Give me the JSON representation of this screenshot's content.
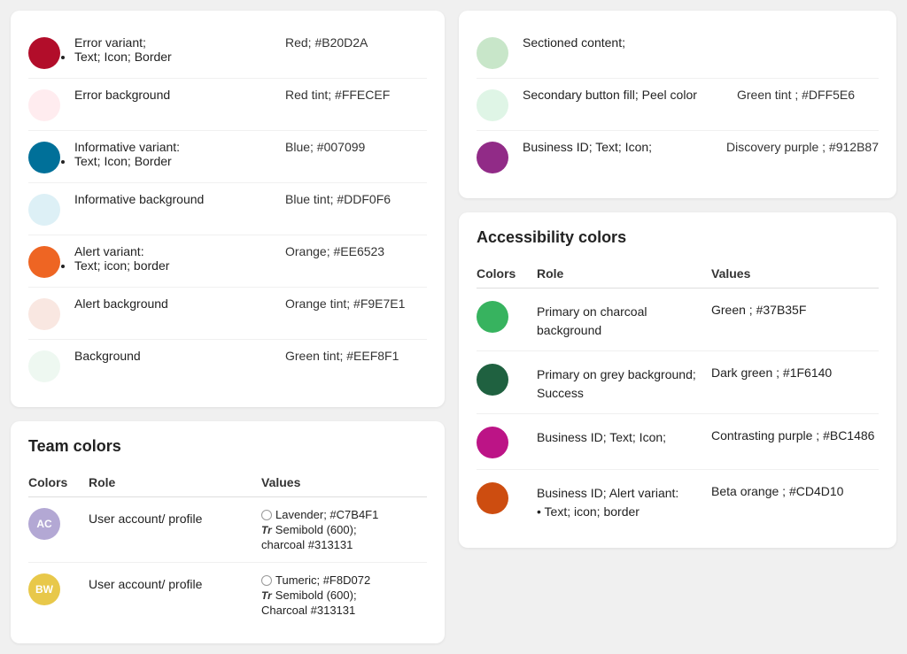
{
  "left": {
    "status_colors": {
      "rows": [
        {
          "color": "#B20D2A",
          "role": "Error variant;",
          "sub": "Text; Icon; Border",
          "value": "Red; #B20D2A"
        },
        {
          "color": "#FFECEF",
          "role": "Error background",
          "sub": null,
          "value": "Red tint; #FFECEF"
        },
        {
          "color": "#007099",
          "role": "Informative variant:",
          "sub": "Text; Icon; Border",
          "value": "Blue; #007099"
        },
        {
          "color": "#DDF0F6",
          "role": "Informative background",
          "sub": null,
          "value": "Blue tint; #DDF0F6"
        },
        {
          "color": "#EE6523",
          "role": "Alert variant:",
          "sub": "Text; icon; border",
          "value": "Orange; #EE6523"
        },
        {
          "color": "#F9E7E1",
          "role": "Alert background",
          "sub": null,
          "value": "Orange tint; #F9E7E1"
        },
        {
          "color": "#EEF8F1",
          "role": "Background",
          "sub": null,
          "value": "Green tint; #EEF8F1"
        }
      ]
    },
    "team_colors": {
      "title": "Team colors",
      "header": {
        "col1": "Colors",
        "col2": "Role",
        "col3": "Values"
      },
      "rows": [
        {
          "avatar_bg": "#b3a8d4",
          "avatar_text": "AC",
          "role": "User account/ profile",
          "values": [
            {
              "type": "circle",
              "text": "Lavender; #C7B4F1"
            },
            {
              "type": "tr",
              "text": "Semibold (600);"
            },
            {
              "type": "text",
              "text": "charcoal #313131"
            }
          ]
        },
        {
          "avatar_bg": "#e8c84a",
          "avatar_text": "BW",
          "role": "User account/ profile",
          "values": [
            {
              "type": "circle",
              "text": "Tumeric; #F8D072"
            },
            {
              "type": "tr",
              "text": "Semibold (600);"
            },
            {
              "type": "text",
              "text": "Charcoal #313131"
            }
          ]
        }
      ]
    }
  },
  "right": {
    "continuation_rows": [
      {
        "color": "#c8e6c9",
        "role": "Sectioned content;",
        "sub": null,
        "value": null
      },
      {
        "color": "#DFF5E6",
        "role": "Secondary button fill; Peel color",
        "sub": null,
        "value": "Green tint ; #DFF5E6"
      },
      {
        "color": "#912B87",
        "role": "Business ID; Text; Icon;",
        "sub": null,
        "value": "Discovery purple ; #912B87"
      }
    ],
    "accessibility": {
      "title": "Accessibility colors",
      "header": {
        "col1": "Colors",
        "col2": "Role",
        "col3": "Values"
      },
      "rows": [
        {
          "color": "#37B35F",
          "role": "Primary on charcoal background",
          "value": "Green ; #37B35F"
        },
        {
          "color": "#1F6140",
          "role": "Primary on grey background; Success",
          "value": "Dark green ; #1F6140"
        },
        {
          "color": "#BC1486",
          "role": "Business ID; Text; Icon;",
          "value": "Contrasting purple ; #BC1486"
        },
        {
          "color": "#CD4D10",
          "role": "Business ID; Alert variant:\n• Text; icon; border",
          "value": "Beta orange ; #CD4D10"
        }
      ]
    }
  }
}
